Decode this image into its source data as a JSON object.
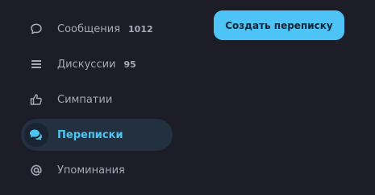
{
  "sidebar": {
    "items": [
      {
        "icon": "chat-bubble-icon",
        "label": "Сообщения",
        "count": "1012",
        "active": false
      },
      {
        "icon": "list-icon",
        "label": "Дискуссии",
        "count": "95",
        "active": false
      },
      {
        "icon": "thumbs-up-icon",
        "label": "Симпатии",
        "count": "",
        "active": false
      },
      {
        "icon": "conversations-icon",
        "label": "Переписки",
        "count": "",
        "active": true
      },
      {
        "icon": "at-sign-icon",
        "label": "Упоминания",
        "count": "",
        "active": false
      }
    ]
  },
  "actions": {
    "create_conversation_label": "Создать переписку"
  },
  "colors": {
    "background": "#1c1d27",
    "accent": "#4dc3f6",
    "active_bg": "#223040",
    "text_muted": "#a7aab8"
  }
}
